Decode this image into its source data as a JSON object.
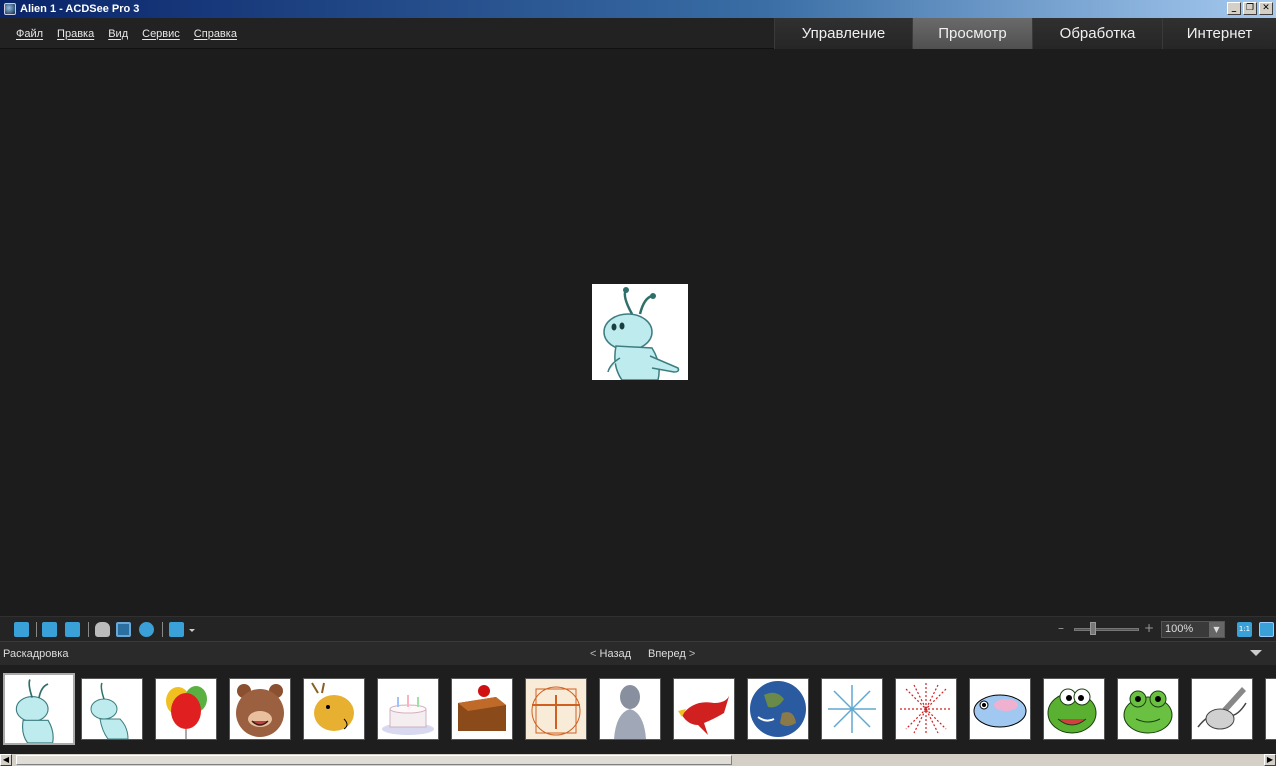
{
  "window": {
    "title": "Alien 1 - ACDSee Pro 3",
    "min": "_",
    "restore": "❐",
    "close": "✕"
  },
  "menu": {
    "items": [
      "Файл",
      "Правка",
      "Вид",
      "Сервис",
      "Справка"
    ]
  },
  "modes": {
    "items": [
      "Управление",
      "Просмотр",
      "Обработка",
      "Интернет"
    ],
    "active": "Просмотр"
  },
  "toolbar": {
    "zoom": "100%",
    "zoom_minus": "–",
    "zoom_plus": "+",
    "actual_size": "1:1"
  },
  "filmstrip": {
    "title": "Раскадровка",
    "back": "Назад",
    "forward": "Вперед",
    "thumbnails": [
      "alien-1",
      "alien-2",
      "balloons",
      "bear",
      "deer",
      "birthday-cake",
      "cake-slice",
      "vitruvian-man",
      "david-statue",
      "dragon",
      "earth",
      "snowflake-burst",
      "fireworks",
      "fish",
      "frog-1",
      "frog-2",
      "hand-drawing"
    ],
    "selected_index": 0
  },
  "colors": {
    "accent": "#3aa0d8",
    "background": "#1c1c1c",
    "active_tab": "#5a5a5a"
  }
}
